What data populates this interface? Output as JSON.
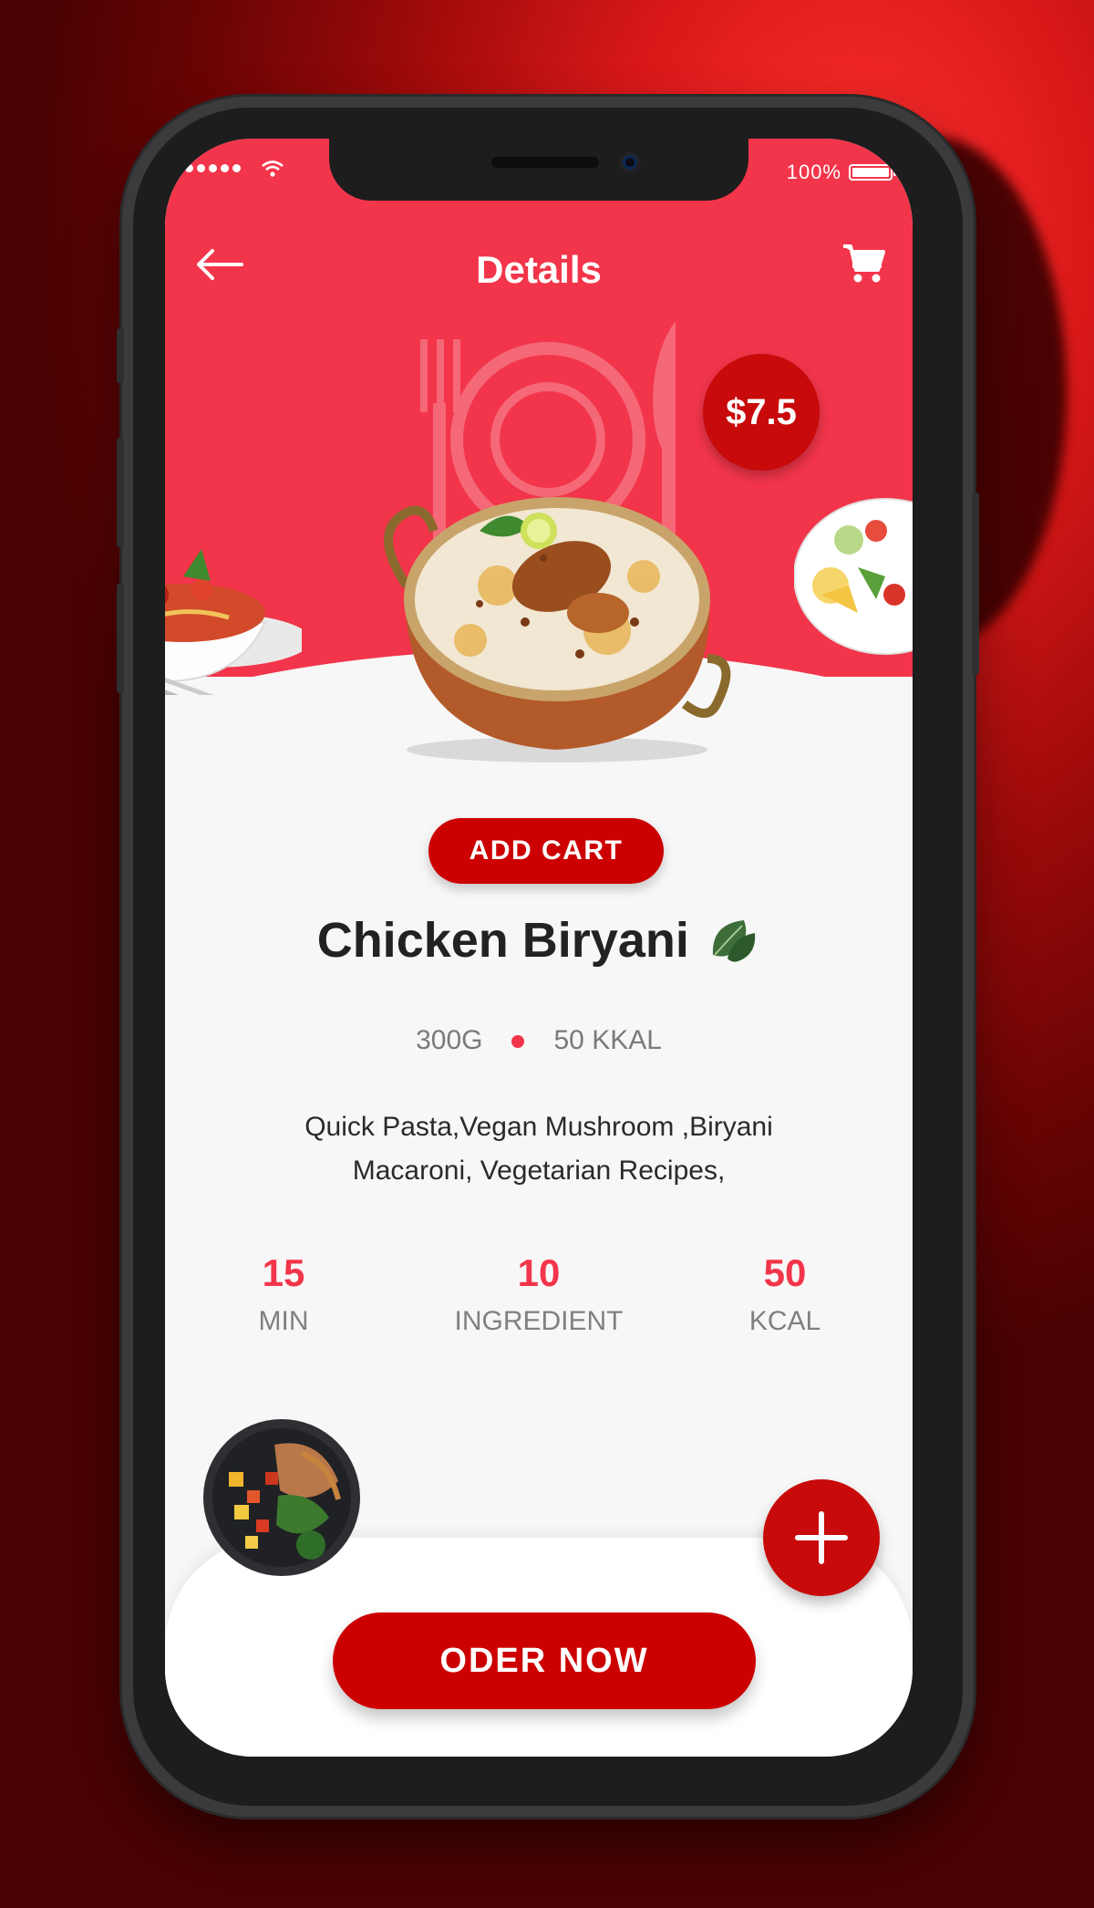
{
  "status_bar": {
    "battery": "100%"
  },
  "header": {
    "title": "Details"
  },
  "product": {
    "price": "$7.5",
    "add_cart_label": "ADD CART",
    "name": "Chicken Biryani",
    "weight": "300G",
    "energy": "50 KKAL",
    "description_line1": "Quick Pasta,Vegan Mushroom ,Biryani",
    "description_line2": "Macaroni, Vegetarian Recipes,"
  },
  "stats": [
    {
      "value": "15",
      "label": "MIN"
    },
    {
      "value": "10",
      "label": "INGREDIENT"
    },
    {
      "value": "50",
      "label": "KCAL"
    }
  ],
  "order_button": {
    "label": "ODER NOW"
  },
  "icons": {
    "back": "arrow-left-icon",
    "cart": "shopping-cart-icon",
    "plus": "plus-icon",
    "leaf": "leaf-icon"
  },
  "colors": {
    "primary": "#f2354a",
    "accent": "#cc0000",
    "background": "#f8f7f8"
  }
}
